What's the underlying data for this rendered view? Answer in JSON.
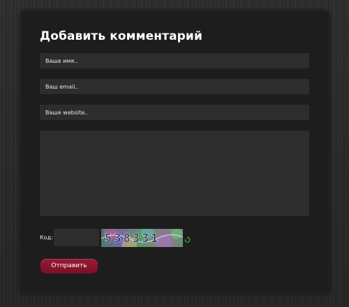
{
  "form": {
    "title": "Добавить комментарий",
    "name_placeholder": "Ваше имя..",
    "email_placeholder": "Ваш email..",
    "website_placeholder": "Ваше website..",
    "comment_placeholder": "",
    "code_label": "Код:",
    "code_value": "",
    "captcha_text": "538331",
    "submit_label": "Отправить"
  },
  "colors": {
    "panel_background": "#1d1d1d",
    "field_background": "#2d2d2d",
    "button_accent": "#8b1430",
    "refresh_icon": "#3aa63a"
  },
  "icons": {
    "refresh": "refresh-icon"
  }
}
